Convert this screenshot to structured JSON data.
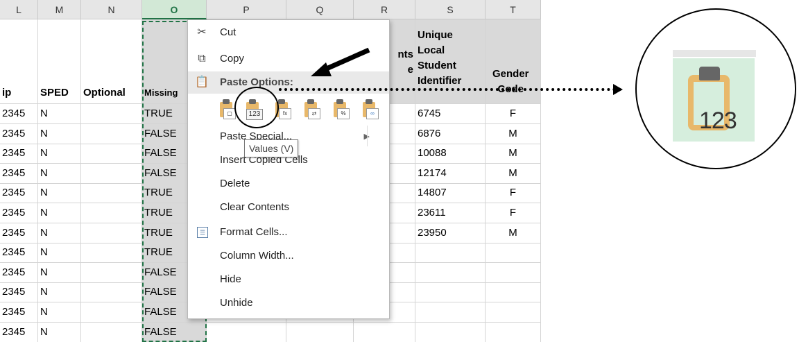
{
  "columns": [
    "L",
    "M",
    "N",
    "O",
    "P",
    "Q",
    "R",
    "S",
    "T"
  ],
  "selected_column": "O",
  "headers": {
    "L": "ip",
    "M": "SPED",
    "N": "Optional",
    "O": "Missing",
    "R": [
      "nts",
      "e"
    ],
    "S": [
      "Unique",
      "Local",
      "Student",
      "Identifier"
    ],
    "T": [
      "Gender",
      "Code"
    ]
  },
  "rows": [
    {
      "L": "2345",
      "M": "N",
      "O": "TRUE",
      "S": "6745",
      "T": "F"
    },
    {
      "L": "2345",
      "M": "N",
      "O": "FALSE",
      "S": "6876",
      "T": "M"
    },
    {
      "L": "2345",
      "M": "N",
      "O": "FALSE",
      "S": "10088",
      "T": "M"
    },
    {
      "L": "2345",
      "M": "N",
      "O": "FALSE",
      "S": "12174",
      "T": "M"
    },
    {
      "L": "2345",
      "M": "N",
      "O": "TRUE",
      "S": "14807",
      "T": "F"
    },
    {
      "L": "2345",
      "M": "N",
      "O": "TRUE",
      "S": "23611",
      "T": "F"
    },
    {
      "L": "2345",
      "M": "N",
      "O": "TRUE",
      "S": "23950",
      "T": "M"
    },
    {
      "L": "2345",
      "M": "N",
      "O": "TRUE",
      "S": "",
      "T": ""
    },
    {
      "L": "2345",
      "M": "N",
      "O": "FALSE",
      "S": "",
      "T": ""
    },
    {
      "L": "2345",
      "M": "N",
      "O": "FALSE",
      "S": "",
      "T": ""
    },
    {
      "L": "2345",
      "M": "N",
      "O": "FALSE",
      "S": "",
      "T": ""
    },
    {
      "L": "2345",
      "M": "N",
      "O": "FALSE",
      "S": "",
      "T": ""
    }
  ],
  "context_menu": {
    "cut": "Cut",
    "copy": "Copy",
    "paste_options": "Paste Options:",
    "paste_special": "Paste Special...",
    "insert_copied_cells": "Insert Copied Cells",
    "delete": "Delete",
    "clear_contents": "Clear Contents",
    "format_cells": "Format Cells...",
    "column_width": "Column Width...",
    "hide": "Hide",
    "unhide": "Unhide"
  },
  "paste_icons": [
    "paste-icon",
    "paste-values-icon",
    "paste-formulas-icon",
    "paste-transpose-icon",
    "paste-formatting-icon",
    "paste-link-icon"
  ],
  "values_badge": "123",
  "tooltip": "Values (V)",
  "zoom_badge": "123",
  "colors": {
    "selected_header_bg": "#d2e8d6",
    "selected_header_text": "#217346",
    "header_shade": "#d9d9d9",
    "clipboard": "#e8b86a"
  }
}
